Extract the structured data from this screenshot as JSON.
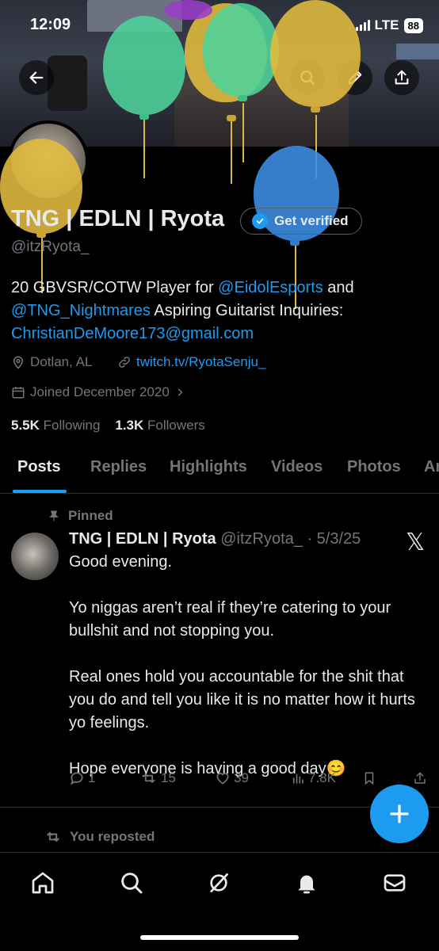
{
  "status_bar": {
    "time": "12:09",
    "network": "LTE",
    "battery": "88"
  },
  "header": {
    "back_icon": "back-arrow-icon",
    "search_icon": "search-icon",
    "edit_icon": "pencil-icon",
    "share_icon": "share-icon"
  },
  "profile": {
    "display_name": "TNG | EDLN | Ryota",
    "verify_button": "Get verified",
    "handle": "@itzRyota_",
    "bio_text1": "20 GBVSR/COTW Player for ",
    "bio_mention1": "@EidolEsports",
    "bio_text2": " and ",
    "bio_mention2": "@TNG_Nightmares",
    "bio_text3": " Aspiring Guitarist Inquiries: ",
    "bio_email": "ChristianDeMoore173@gmail.com",
    "location": "Dotlan, AL",
    "website": "twitch.tv/RyotaSenju_",
    "joined": "Joined December 2020",
    "following_count": "5.5K",
    "following_label": "Following",
    "followers_count": "1.3K",
    "followers_label": "Followers"
  },
  "tabs": [
    "Posts",
    "Replies",
    "Highlights",
    "Videos",
    "Photos",
    "Ar"
  ],
  "post": {
    "pinned_label": "Pinned",
    "author": "TNG | EDLN | Ryota",
    "handle": "@itzRyota_",
    "date": "· 5/3/25",
    "paragraphs": [
      "Good evening.",
      "Yo niggas aren’t real if they’re catering to your bullshit and not stopping you.",
      "Real ones hold you accountable for the shit that you do and tell you like it is no matter how it hurts yo feelings.",
      "Hope everyone is having a good day😊"
    ],
    "replies": "1",
    "reposts": "15",
    "likes": "39",
    "views": "7.8K"
  },
  "repost_notice": "You reposted",
  "colors": {
    "accent": "#1d9bf0",
    "background": "#000000",
    "muted": "#71767b",
    "text": "#e7e9ea"
  }
}
